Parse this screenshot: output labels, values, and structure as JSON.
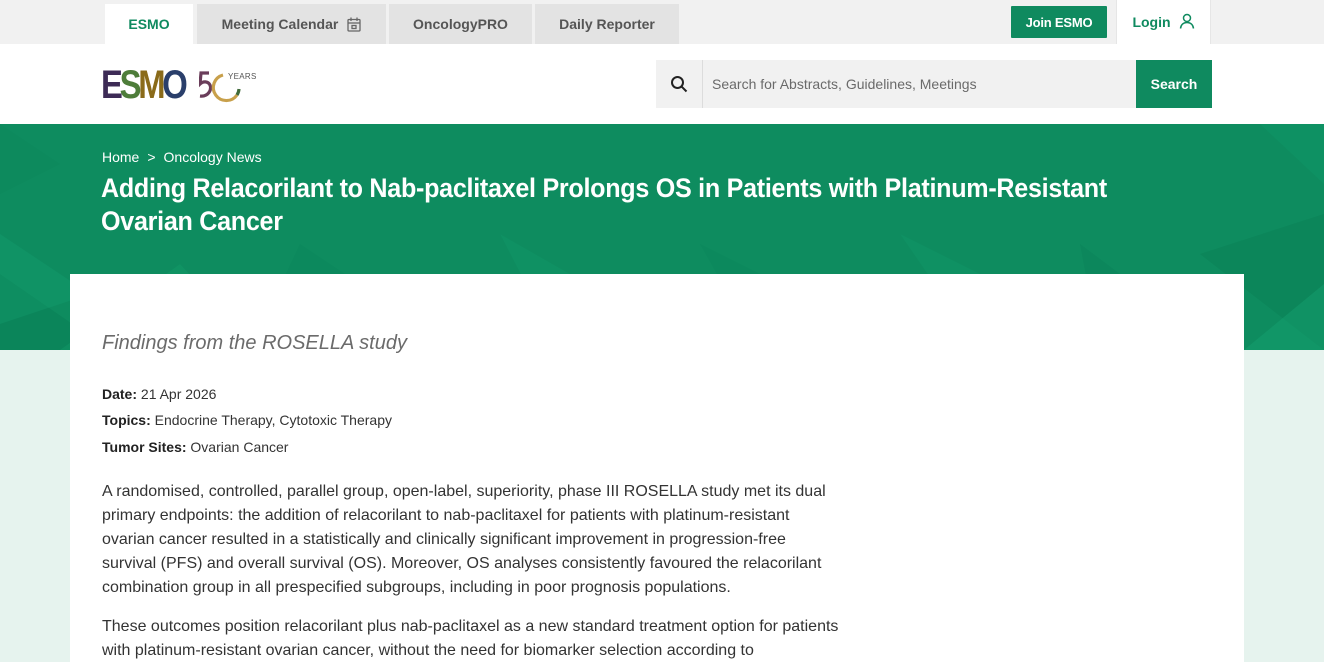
{
  "topnav": {
    "tabs": [
      {
        "label": "ESMO",
        "active": true
      },
      {
        "label": "Meeting Calendar",
        "icon": "calendar-icon"
      },
      {
        "label": "OncologyPRO"
      },
      {
        "label": "Daily Reporter"
      }
    ],
    "join_label": "Join ESMO",
    "login_label": "Login",
    "login_icon": "user-icon"
  },
  "header": {
    "logo_text": "ESMO",
    "logo_years": "YEARS",
    "search_placeholder": "Search for Abstracts, Guidelines, Meetings",
    "search_button": "Search"
  },
  "hero": {
    "breadcrumb": [
      "Home",
      "Oncology News"
    ],
    "breadcrumb_sep": ">",
    "title": "Adding Relacorilant to Nab-paclitaxel Prolongs OS in Patients with Platinum-Resistant Ovarian Cancer"
  },
  "article": {
    "subtitle": "Findings from the ROSELLA study",
    "meta": {
      "date_label": "Date:",
      "date_value": "21 Apr 2026",
      "topics_label": "Topics:",
      "topics_value": "Endocrine Therapy, Cytotoxic Therapy",
      "sites_label": "Tumor Sites:",
      "sites_value": "Ovarian Cancer"
    },
    "paragraphs": [
      "A randomised, controlled, parallel group, open-label, superiority, phase III ROSELLA  study met its dual primary endpoints: the addition of relacorilant to nab-paclitaxel for patients with platinum-resistant ovarian cancer resulted in a statistically and clinically significant improvement in progression-free survival (PFS) and overall survival (OS). Moreover, OS analyses consistently favoured the relacorilant combination group in all prespecified subgroups, including in poor prognosis populations.",
      "These outcomes position relacorilant plus nab-paclitaxel as a new standard treatment option for patients with platinum-resistant ovarian cancer, without the need for biomarker selection according to"
    ]
  },
  "colors": {
    "brand_green": "#0f8a5f",
    "hero_green": "#0e8c5f",
    "page_tint": "#e6f3ee"
  }
}
